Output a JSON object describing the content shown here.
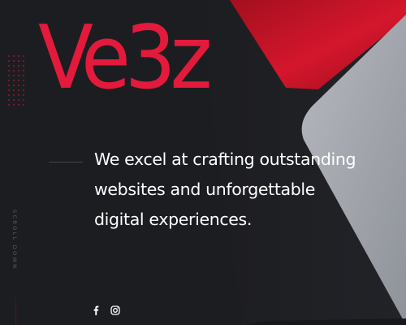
{
  "brand": {
    "logo_text": "Ve3z"
  },
  "hero": {
    "tagline": "We excel at crafting outstanding websites and unforgettable digital experiences.",
    "scroll_label": "SCROLL DOWN"
  },
  "social": {
    "icons": [
      "facebook-icon",
      "instagram-icon"
    ]
  },
  "colors": {
    "background": "#1c1d21",
    "accent": "#e31a3c",
    "text": "#ffffff",
    "panel_grey": "#a9adb4",
    "panel_red": "#c81224"
  }
}
